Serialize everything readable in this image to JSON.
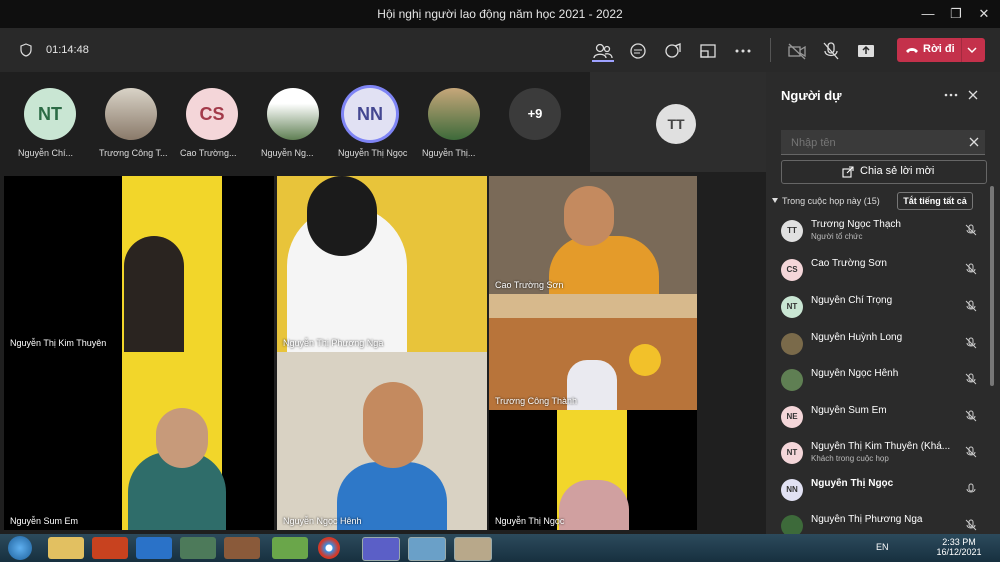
{
  "window": {
    "title": "Hội nghị người lao động năm học 2021 - 2022"
  },
  "toolbar": {
    "timer": "01:14:48",
    "leave_label": "Rời đi"
  },
  "gallery": [
    {
      "initials": "NT",
      "name": "Nguyễn Chí...",
      "color": "#c9e6d3"
    },
    {
      "initials": "",
      "name": "Trương Công T...",
      "color": "#8a7a6a"
    },
    {
      "initials": "CS",
      "name": "Cao Trường...",
      "color": "#f4d6d9"
    },
    {
      "initials": "",
      "name": "Nguyễn Ng...",
      "color": "#5f7f53"
    },
    {
      "initials": "NN",
      "name": "Nguyễn Thị Ngọc",
      "color": "#e1e1f3"
    },
    {
      "initials": "",
      "name": "Nguyễn Thị...",
      "color": "#3d6a3a"
    },
    {
      "initials": "+9",
      "name": "",
      "color": "#3b3b3b"
    }
  ],
  "self_tile": {
    "initials": "TT"
  },
  "videos": [
    {
      "label": "Nguyễn Thị Kim Thuyên"
    },
    {
      "label": "Nguyễn Thị Phương Nga"
    },
    {
      "label": "Cao Trường Sơn"
    },
    {
      "label": "Trương Công Thành"
    },
    {
      "label": "Nguyễn Sum Em"
    },
    {
      "label": "Nguyễn Ngọc Hênh"
    },
    {
      "label": "Nguyễn Thị Ngọc"
    }
  ],
  "panel": {
    "title": "Người dự",
    "search_placeholder": "Nhập tên",
    "share_label": "Chia sẻ lời mời",
    "section_label": "Trong cuộc họp này (15)",
    "mute_all_label": "Tắt tiếng tất cả",
    "participants": [
      {
        "initials": "TT",
        "name": "Trương Ngọc Thạch",
        "sub": "Người tổ chức",
        "color": "#e0e0e0"
      },
      {
        "initials": "CS",
        "name": "Cao Trường Sơn",
        "sub": "",
        "color": "#f4d6d9"
      },
      {
        "initials": "NT",
        "name": "Nguyễn Chí Trọng",
        "sub": "",
        "color": "#c9e6d3"
      },
      {
        "initials": "",
        "name": "Nguyễn Huỳnh Long",
        "sub": "",
        "color": "#7a6a4a"
      },
      {
        "initials": "",
        "name": "Nguyễn Ngọc Hênh",
        "sub": "",
        "color": "#5f7f53"
      },
      {
        "initials": "NE",
        "name": "Nguyễn Sum Em",
        "sub": "",
        "color": "#f4d6d9"
      },
      {
        "initials": "NT",
        "name": "Nguyễn Thị Kim Thuyên (Khá...",
        "sub": "Khách trong cuộc họp",
        "color": "#f4d6d9"
      },
      {
        "initials": "NN",
        "name": "Nguyễn Thị Ngọc",
        "sub": "",
        "color": "#e1e1f3"
      },
      {
        "initials": "",
        "name": "Nguyễn Thị Phương Nga",
        "sub": "",
        "color": "#3d6a3a"
      }
    ]
  },
  "taskbar": {
    "lang": "EN",
    "time": "2:33 PM",
    "date": "16/12/2021"
  }
}
